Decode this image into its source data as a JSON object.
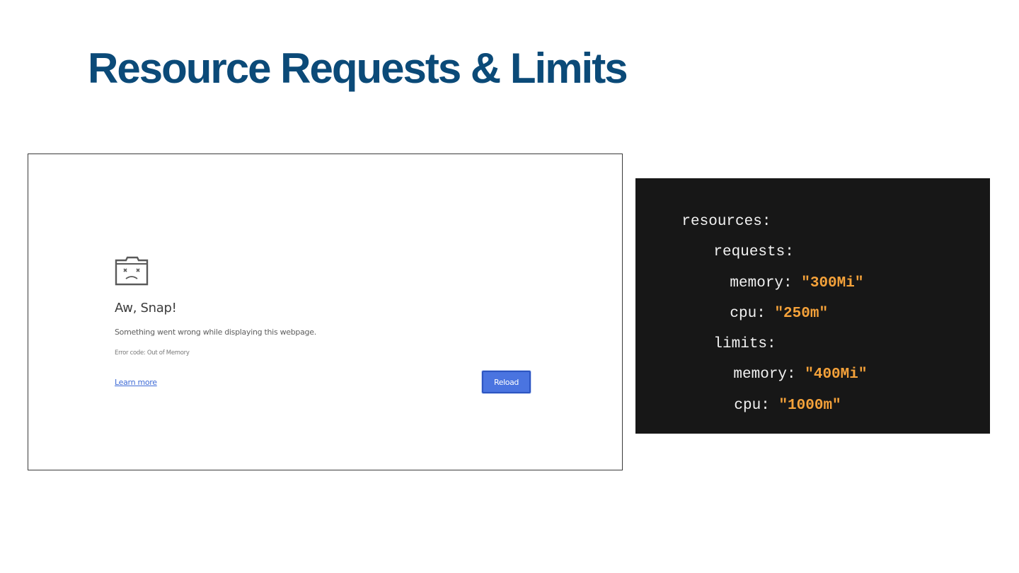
{
  "slide": {
    "title": "Resource Requests & Limits"
  },
  "error_page": {
    "icon": "sad-tab-icon",
    "heading": "Aw, Snap!",
    "message": "Something went wrong while displaying this webpage.",
    "error_code": "Error code: Out of Memory",
    "learn_more": "Learn more",
    "reload": "Reload"
  },
  "code": {
    "resources_key": "resources:",
    "requests_key": "requests:",
    "requests_memory_key": "memory: ",
    "requests_memory_value": "\"300Mi\"",
    "requests_cpu_key": "cpu: ",
    "requests_cpu_value": "\"250m\"",
    "limits_key": "limits:",
    "limits_memory_key": "memory: ",
    "limits_memory_value": "\"400Mi\"",
    "limits_cpu_key": "cpu: ",
    "limits_cpu_value": "\"1000m\""
  },
  "colors": {
    "title": "#0b4a78",
    "code_background": "#171717",
    "code_value": "#f5a23a",
    "reload_button": "#4a74e0"
  }
}
